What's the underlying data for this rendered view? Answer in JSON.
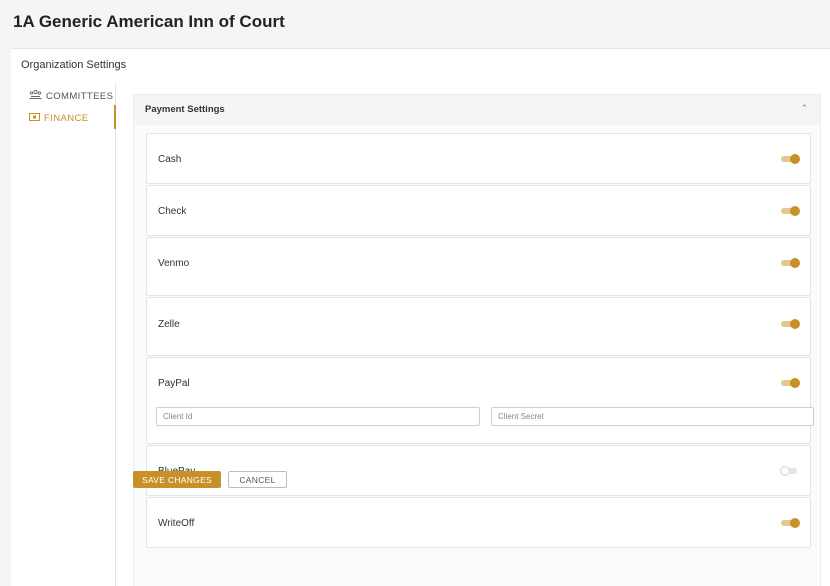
{
  "header": {
    "title": "1A Generic American Inn of Court"
  },
  "org_settings": {
    "title": "Organization Settings"
  },
  "sidebar": {
    "items": [
      {
        "label": "COMMITTEES",
        "icon": "committee-icon",
        "active": false
      },
      {
        "label": "FINANCE",
        "icon": "finance-icon",
        "active": true
      }
    ]
  },
  "payment_settings": {
    "title": "Payment Settings",
    "methods": [
      {
        "label": "Cash",
        "enabled": true
      },
      {
        "label": "Check",
        "enabled": true
      },
      {
        "label": "Venmo",
        "enabled": true
      },
      {
        "label": "Zelle",
        "enabled": true
      },
      {
        "label": "PayPal",
        "enabled": true,
        "client_id_placeholder": "Client Id",
        "client_secret_placeholder": "Client Secret"
      },
      {
        "label": "BluePay",
        "enabled": false
      },
      {
        "label": "WriteOff",
        "enabled": true
      }
    ]
  },
  "actions": {
    "save_label": "SAVE CHANGES",
    "cancel_label": "CANCEL"
  },
  "colors": {
    "accent": "#c9902a",
    "accent_light": "#e3c78c",
    "background": "#f4f5f7"
  }
}
